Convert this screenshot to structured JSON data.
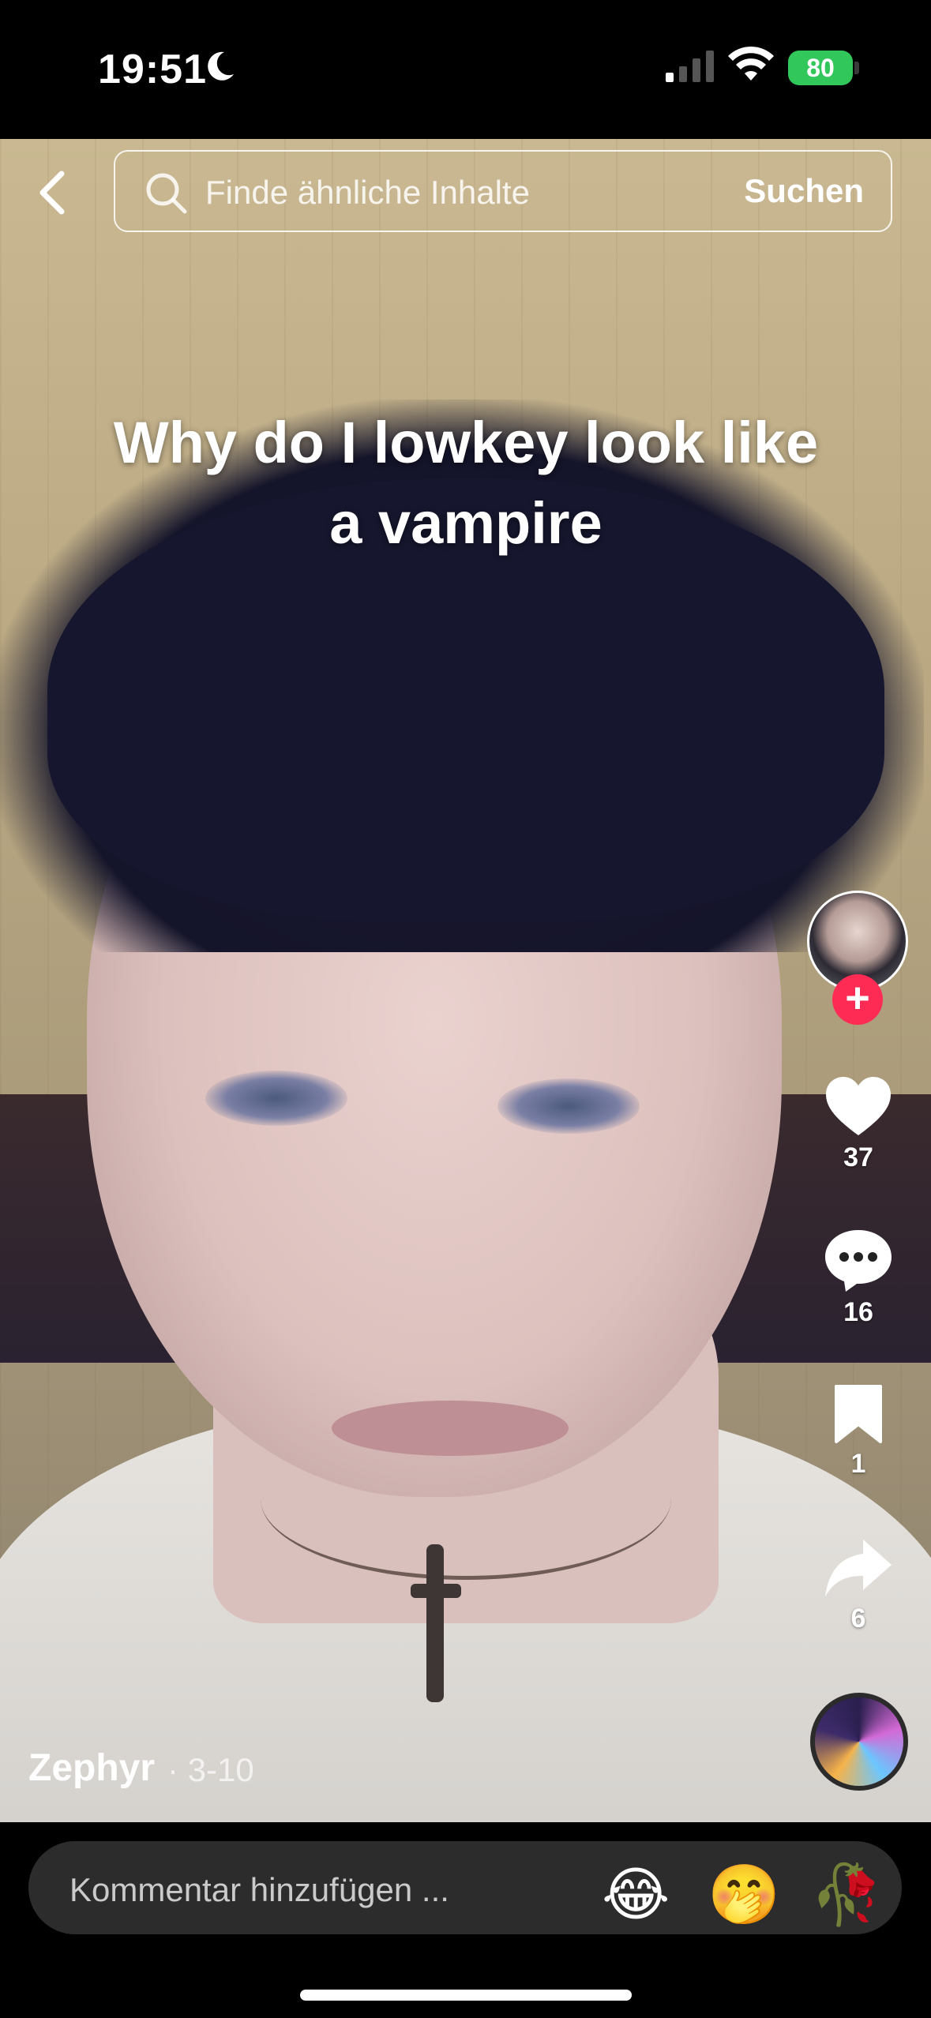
{
  "status_bar": {
    "time": "19:51",
    "battery": "80"
  },
  "top": {
    "search_placeholder": "Finde ähnliche Inhalte",
    "search_button": "Suchen"
  },
  "video": {
    "caption": "Why do I lowkey look like a vampire"
  },
  "author": {
    "name": "Zephyr",
    "date": "· 3-10"
  },
  "rail": {
    "likes": "37",
    "comments": "16",
    "saves": "1",
    "shares": "6"
  },
  "comment_bar": {
    "placeholder": "Kommentar hinzufügen ...",
    "emojis": [
      "😂",
      "🤭",
      "🥀"
    ]
  },
  "colors": {
    "follow": "#fe2c55",
    "battery": "#32c75a"
  }
}
